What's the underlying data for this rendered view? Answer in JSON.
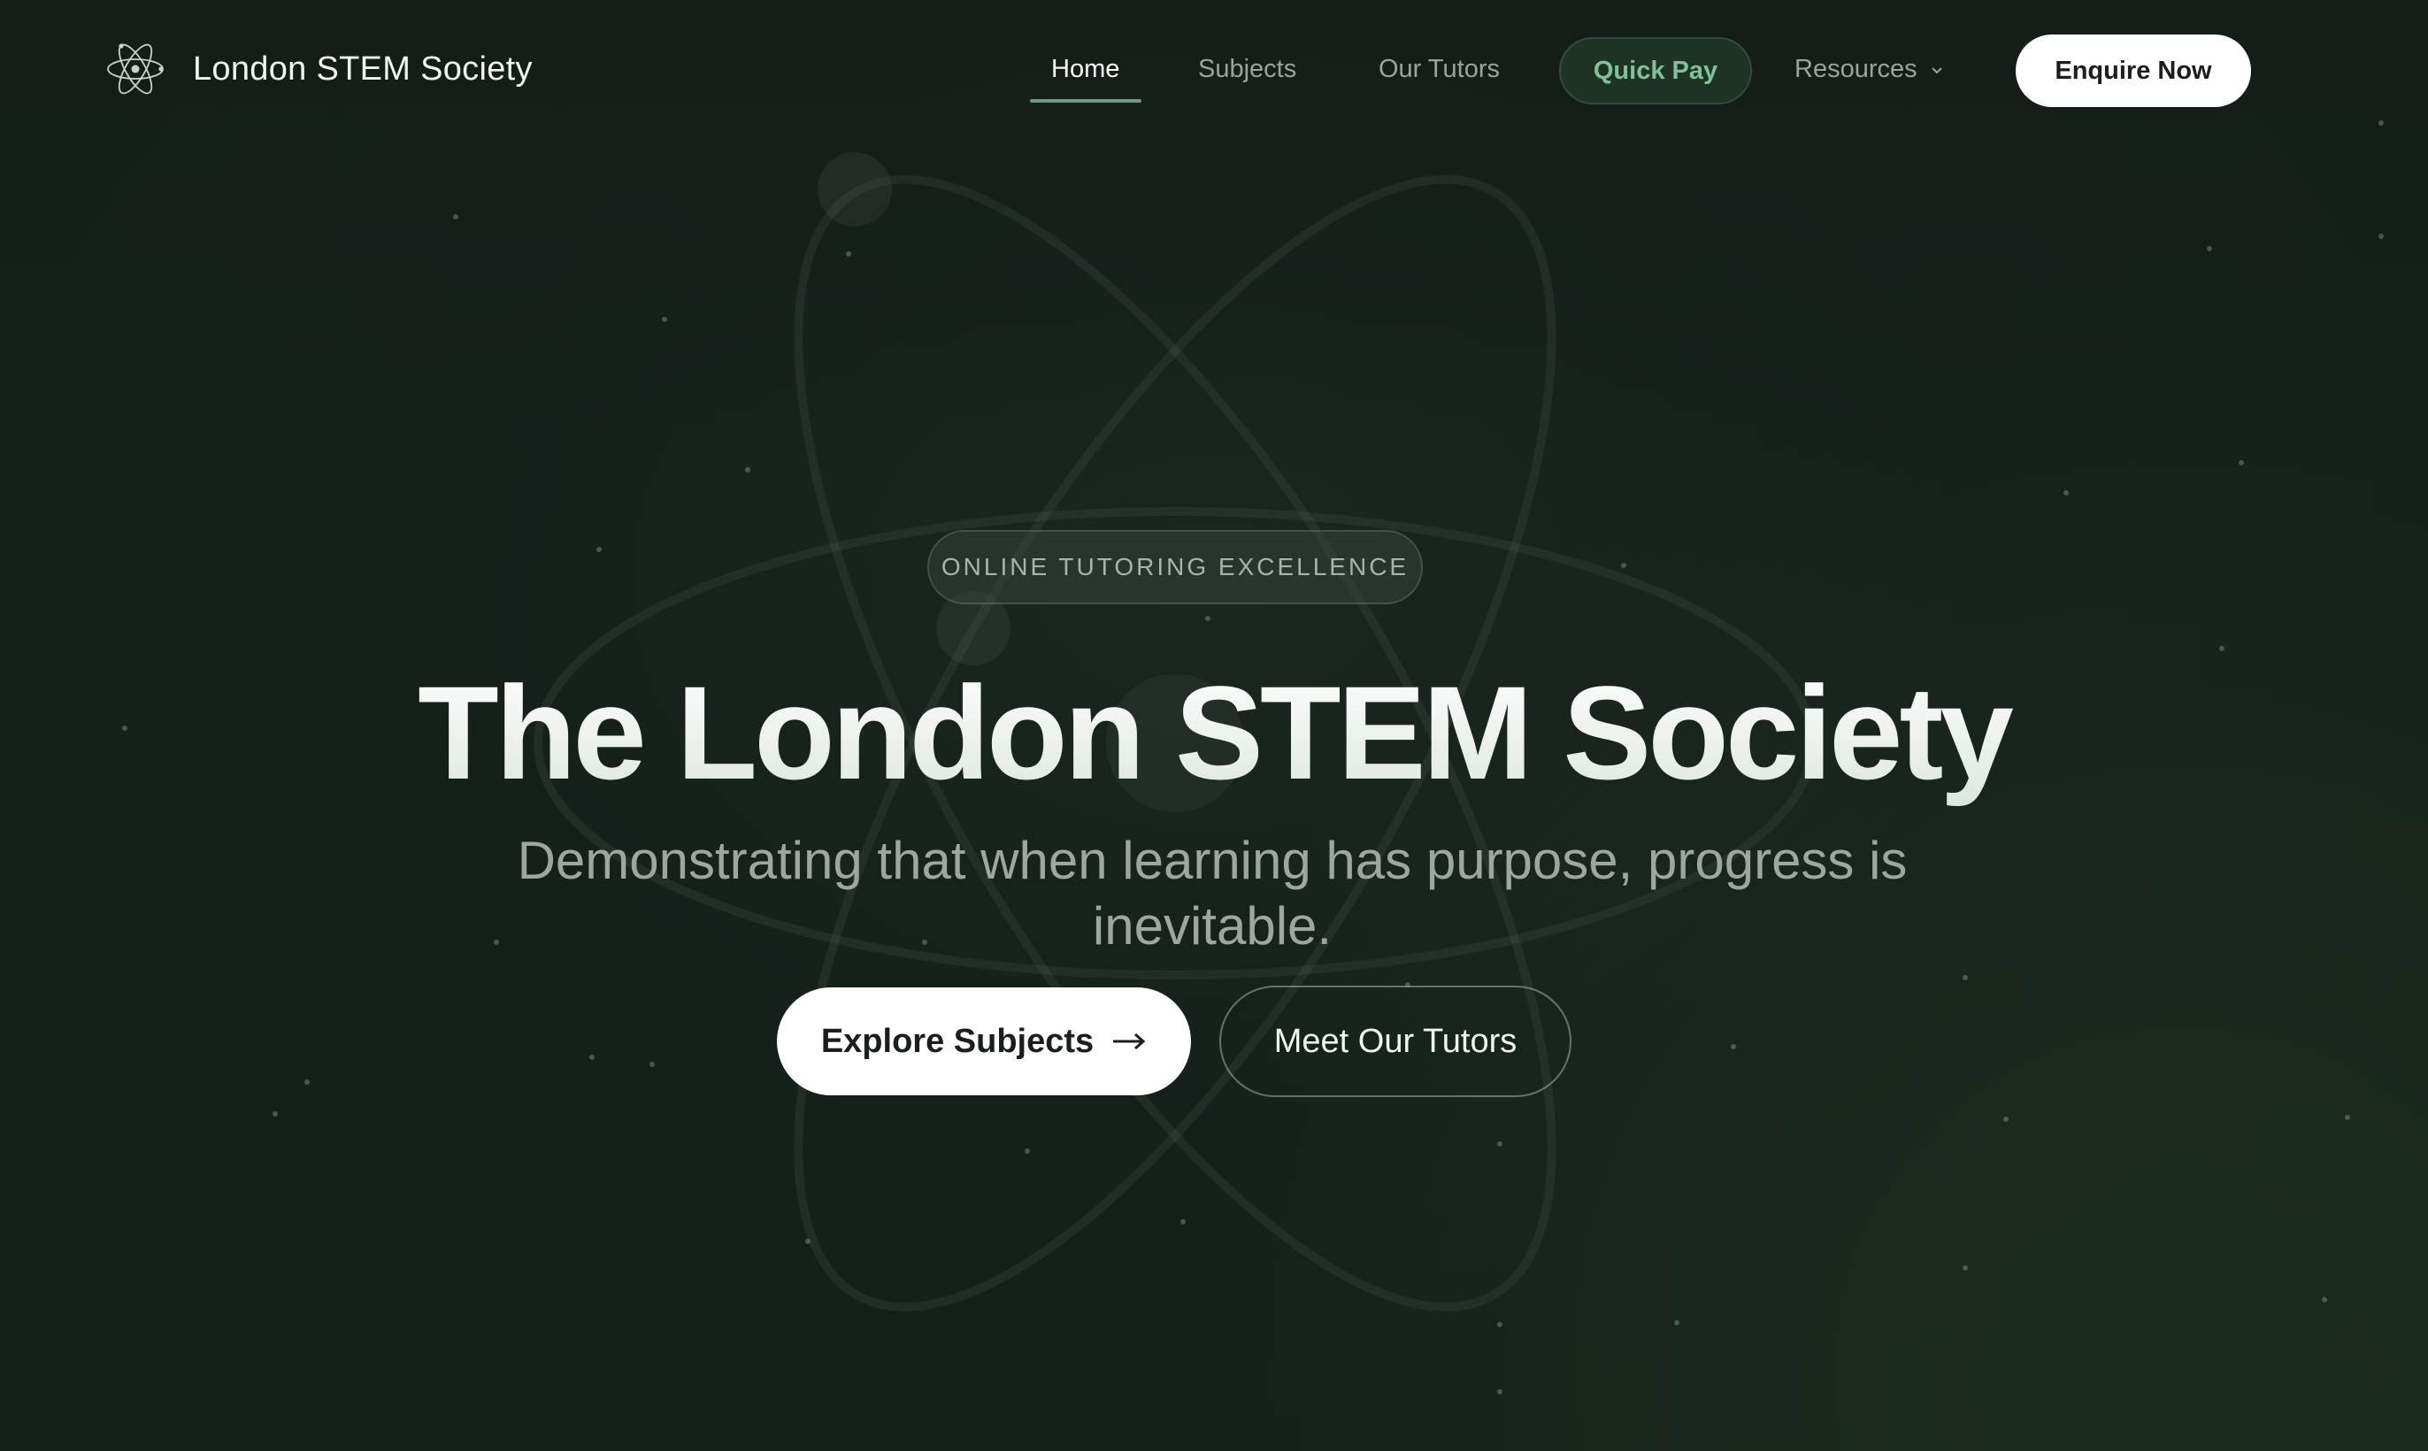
{
  "brand": {
    "name": "London STEM Society",
    "icon": "atom-icon"
  },
  "nav": {
    "home": "Home",
    "subjects": "Subjects",
    "tutors": "Our Tutors",
    "quick_pay": "Quick Pay",
    "resources": "Resources",
    "enquire": "Enquire Now"
  },
  "hero": {
    "pill": "ONLINE TUTORING EXCELLENCE",
    "title": "The London STEM Society",
    "subtitle": "Demonstrating that when learning has purpose, progress is inevitable.",
    "primary_button": "Explore Subjects",
    "secondary_button": "Meet Our Tutors"
  },
  "colors": {
    "background": "#16201b",
    "accent": "#7fc29a",
    "quick_pay_bg": "#1e3326",
    "home_underline": "#6f9a80"
  }
}
